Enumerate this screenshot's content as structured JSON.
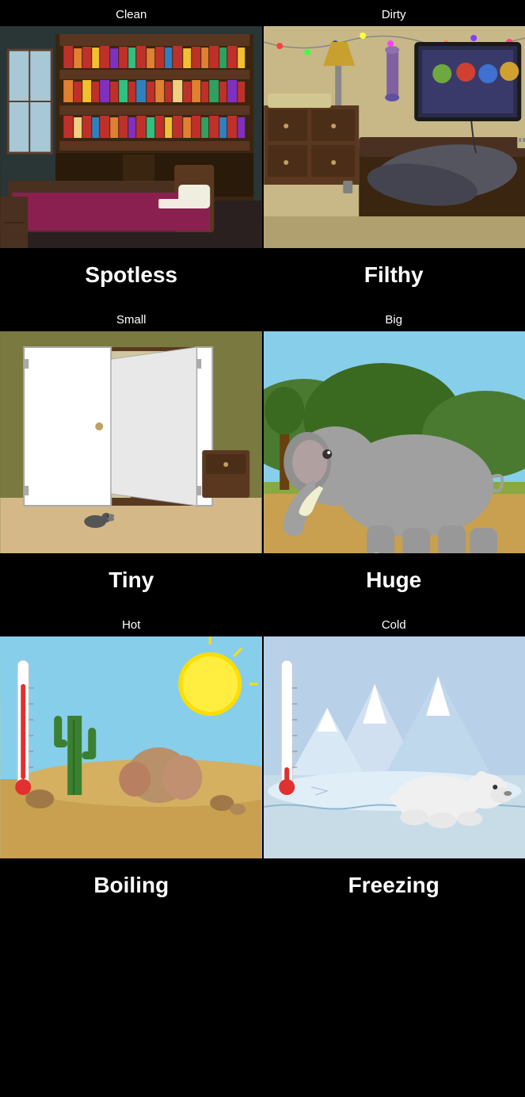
{
  "pairs": [
    {
      "top_left_label": "Clean",
      "top_right_label": "Dirty",
      "bottom_left_label": "Spotless",
      "bottom_right_label": "Filthy",
      "left_scene": "clean-bedroom",
      "right_scene": "dirty-bedroom"
    },
    {
      "top_left_label": "Small",
      "top_right_label": "Big",
      "bottom_left_label": "Tiny",
      "bottom_right_label": "Huge",
      "left_scene": "small-closet",
      "right_scene": "big-elephant"
    },
    {
      "top_left_label": "Hot",
      "top_right_label": "Cold",
      "bottom_left_label": "Boiling",
      "bottom_right_label": "Freezing",
      "left_scene": "hot-desert",
      "right_scene": "cold-arctic"
    }
  ]
}
